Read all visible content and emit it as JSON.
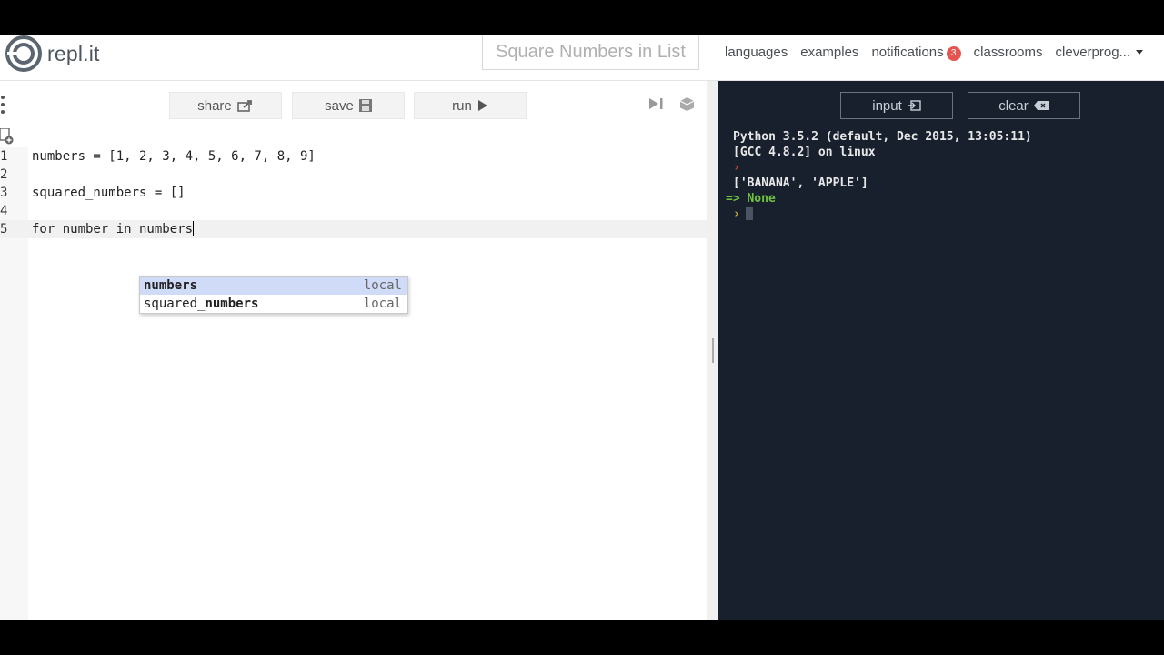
{
  "app": {
    "logo_text": "repl.it",
    "title": "Square Numbers in List"
  },
  "nav": {
    "languages": "languages",
    "examples": "examples",
    "notifications": "notifications",
    "notifications_count": "3",
    "classrooms": "classrooms",
    "user": "cleverprog..."
  },
  "toolbar": {
    "share_label": "share",
    "save_label": "save",
    "run_label": "run"
  },
  "editor": {
    "line_numbers": [
      "1",
      "2",
      "3",
      "4",
      "5"
    ],
    "active_line": 5,
    "lines": [
      "numbers = [1, 2, 3, 4, 5, 6, 7, 8, 9]",
      "",
      "squared_numbers = []",
      "",
      "for number in numbers"
    ],
    "autocomplete": [
      {
        "prefix": "",
        "match": "numbers",
        "meta": "local",
        "selected": true
      },
      {
        "prefix": "squared_",
        "match": "numbers",
        "meta": "local",
        "selected": false
      }
    ]
  },
  "console": {
    "input_label": "input",
    "clear_label": "clear",
    "lines": [
      "Python 3.5.2 (default, Dec 2015, 13:05:11)",
      "[GCC 4.8.2] on linux"
    ],
    "prompt_glyph": "›",
    "output": "['BANANA', 'APPLE']",
    "result_prefix": "=>",
    "result_value": "None"
  },
  "colors": {
    "console_bg": "#18202e",
    "badge": "#e5554f",
    "autocomplete_selected": "#cfdbf7",
    "keyword": "#0b2ea5",
    "result_green": "#6fc23f"
  }
}
